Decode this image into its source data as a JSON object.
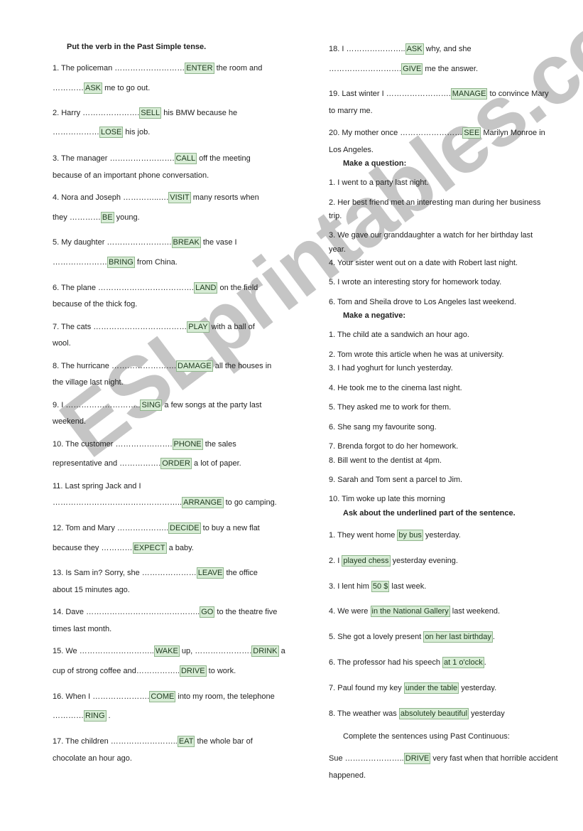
{
  "section1": {
    "title": "Put the verb in the Past Simple tense.",
    "items": [
      {
        "l1a": "1.  The policeman ………………………",
        "b1": "ENTER",
        "l1b": " the room and",
        "l2a": "…………",
        "b2": "ASK",
        "l2b": " me to go out."
      },
      {
        "l1a": "2.  Harry ………………….",
        "b1": "SELL",
        "l1b": " his BMW because he",
        "l2a": "………………",
        "b2": "LOSE",
        "l2b": " his job."
      },
      {
        "l1a": "3.  The manager …………………….",
        "b1": "CALL",
        "l1b": " off the meeting",
        "l2a": "because of an important phone conversation.",
        "b2": "",
        "l2b": ""
      },
      {
        "l1a": "4.  Nora and Joseph …………..….",
        "b1": "VISIT",
        "l1b": " many resorts when",
        "l2a": "they …………",
        "b2": "BE",
        "l2b": " young."
      },
      {
        "l1a": "5.  My daughter …………………….",
        "b1": "BREAK",
        "l1b": " the vase I",
        "l2a": "…………………",
        "b2": "BRING",
        "l2b": " from China."
      },
      {
        "l1a": "6.  The plane ……………………………….",
        "b1": "LAND",
        "l1b": " on the field",
        "l2a": "because of the thick fog.",
        "b2": "",
        "l2b": ""
      },
      {
        "l1a": "7.  The cats ………………………………",
        "b1": "PLAY",
        "l1b": " with a ball of",
        "l2a": "wool.",
        "b2": "",
        "l2b": ""
      },
      {
        "l1a": "8.  The hurricane …………………….",
        "b1": "DAMAGE",
        "l1b": " all the houses in",
        "l2a": "the village last night.",
        "b2": "",
        "l2b": ""
      },
      {
        "l1a": "9.  I ………………………..",
        "b1": "SING",
        "l1b": " a few songs at the party last",
        "l2a": "weekend.",
        "b2": "",
        "l2b": ""
      },
      {
        "l1a": "10. The customer ………………….",
        "b1": "PHONE",
        "l1b": " the sales",
        "l2a": "representative and …………….",
        "b2": "ORDER",
        "l2b": " a lot of paper."
      },
      {
        "l1a": "11. Last spring Jack and I",
        "b1": "",
        "l1b": "",
        "l2a": "…………………………………………..",
        "b2": "ARRANGE",
        "l2b": " to go camping."
      },
      {
        "l1a": "12. Tom and Mary ………………..",
        "b1": "DECIDE",
        "l1b": " to buy a new flat",
        "l2a": "because they …………",
        "b2": "EXPECT",
        "l2b": " a baby."
      },
      {
        "l1a": "13. Is Sam in? Sorry, she …………………",
        "b1": "LEAVE",
        "l1b": " the office",
        "l2a": "about 15 minutes ago.",
        "b2": "",
        "l2b": ""
      },
      {
        "l1a": "14. Dave ……………………………………..",
        "b1": "GO",
        "l1b": " to the theatre five",
        "l2a": "times last month.",
        "b2": "",
        "l2b": ""
      },
      {
        "l1a": "15. We ………………………..",
        "b1": "WAKE",
        "l1b": " up, ………………….",
        "b1b": "DRINK",
        "l1c": " a",
        "l2a": "cup of strong coffee and……………..",
        "b2": "DRIVE",
        "l2b": " to work."
      },
      {
        "l1a": "16. When I ………………….",
        "b1": "COME",
        "l1b": " into my room, the telephone",
        "l2a": "…………",
        "b2": "RING",
        "l2b": " ."
      },
      {
        "l1a": "17. The children ……………………..",
        "b1": "EAT",
        "l1b": " the whole bar of",
        "l2a": "chocolate an hour ago.",
        "b2": "",
        "l2b": ""
      },
      {
        "l1a": "18. I …………………..",
        "b1": "ASK",
        "l1b": " why, and she",
        "l2a": "……………………….",
        "b2": "GIVE",
        "l2b": " me the answer."
      },
      {
        "l1a": "19. Last winter I …………………….",
        "b1": "MANAGE",
        "l1b": " to convince Mary",
        "l2a": "to marry me.",
        "b2": "",
        "l2b": ""
      },
      {
        "l1a": "20. My mother once ……………………",
        "b1": "SEE",
        "l1b": " Marilyn Monroe in",
        "l2a": "Los Angeles.",
        "b2": "",
        "l2b": ""
      }
    ]
  },
  "section2": {
    "title": "Make a question:",
    "items": [
      "1.   I went to a party last night.",
      "2.   Her best friend met an interesting man during her business",
      "trip.",
      "3.   We gave our granddaughter a watch for her birthday last",
      "year.",
      "4.   Your sister went out on a date with Robert last night.",
      "5.   I wrote an interesting story for homework today.",
      "6.   Tom and Sheila drove to Los Angeles last weekend."
    ]
  },
  "section3": {
    "title": "Make a negative:",
    "items": [
      "1.   The child ate a sandwich an hour ago.",
      "2.   Tom wrote this article when he was at university.",
      "3.   I had yoghurt for lunch yesterday.",
      "4.   He took me to the cinema last night.",
      "5.   They asked me to work for them.",
      "6.   She sang  my favourite song.",
      "7.   Brenda forgot to do her homework.",
      "8.   Bill went to the dentist at 4pm.",
      "9.   Sarah and Tom sent a parcel to Jim.",
      "10. Tim woke up late this morning"
    ]
  },
  "section4": {
    "title": "Ask about the underlined part of the sentence.",
    "items": [
      {
        "a": "1.   They went home ",
        "b": "by bus",
        "c": " yesterday."
      },
      {
        "a": "2.   I ",
        "b": "played chess",
        "c": " yesterday evening."
      },
      {
        "a": "3.   I lent him ",
        "b": "50 $",
        "c": " last week."
      },
      {
        "a": "4.   We were ",
        "b": "in the National Gallery",
        "c": " last weekend."
      },
      {
        "a": "5.   She got a lovely present ",
        "b": "on her last birthday",
        "c": "."
      },
      {
        "a": "6.   The professor had his speech ",
        "b": "at 1 o'clock",
        "c": "."
      },
      {
        "a": "7.   Paul found my key ",
        "b": "under the table",
        "c": " yesterday."
      },
      {
        "a": "8.   The weather was ",
        "b": "absolutely beautiful",
        "c": " yesterday"
      }
    ]
  },
  "section5": {
    "title": "Complete the sentences using Past Continuous:",
    "l1a": "Sue …………………..",
    "b1": "DRIVE",
    "l1b": " very fast when that horrible accident",
    "l2": "happened."
  },
  "watermark": "ESLprintables.com",
  "colors": {
    "box_fill": "#d7ecd5",
    "box_border": "#8fb48c"
  }
}
